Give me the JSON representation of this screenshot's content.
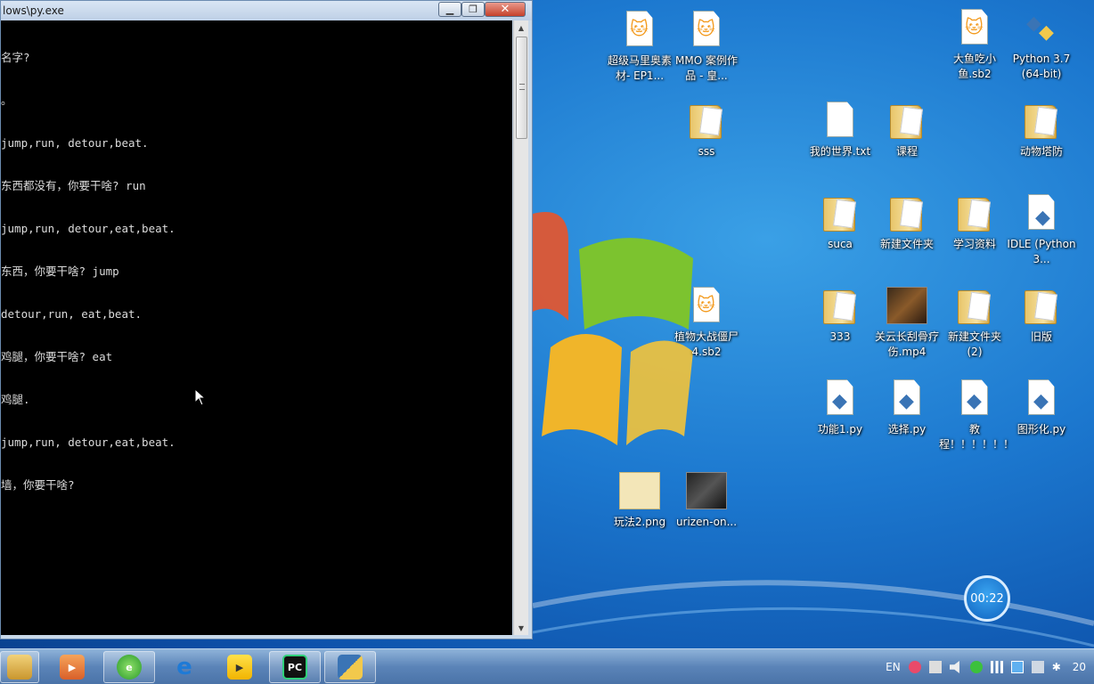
{
  "console": {
    "title": "lows\\py.exe",
    "lines": [
      "名字?",
      "。",
      "jump,run, detour,beat.",
      "东西都没有，你要干啥? run",
      "jump,run, detour,eat,beat.",
      "东西，你要干啥? jump",
      "detour,run, eat,beat.",
      "鸡腿，你要干啥? eat",
      "鸡腿.",
      "jump,run, detour,eat,beat.",
      "墙，你要干啥?"
    ]
  },
  "desktop": {
    "icons": [
      {
        "label": "超级马里奥素材- EP1..."
      },
      {
        "label": "MMO 案例作品 - 皇..."
      },
      {
        "label": "大鱼吃小鱼.sb2"
      },
      {
        "label": "Python 3.7 (64-bit)"
      },
      {
        "label": "sss"
      },
      {
        "label": "我的世界.txt"
      },
      {
        "label": "课程"
      },
      {
        "label": "动物塔防"
      },
      {
        "label": "suca"
      },
      {
        "label": "新建文件夹"
      },
      {
        "label": "学习资料"
      },
      {
        "label": "IDLE (Python 3..."
      },
      {
        "label": "植物大战僵尸4.sb2"
      },
      {
        "label": "333"
      },
      {
        "label": "关云长刮骨疗伤.mp4"
      },
      {
        "label": "新建文件夹 (2)"
      },
      {
        "label": "旧版"
      },
      {
        "label": "功能1.py"
      },
      {
        "label": "选择.py"
      },
      {
        "label": "教程！！！！！！！.py"
      },
      {
        "label": "图形化.py"
      },
      {
        "label": "玩法2.png"
      },
      {
        "label": "urizen-on..."
      }
    ]
  },
  "timer": {
    "value": "00:22"
  },
  "tray": {
    "lang": "EN",
    "clock": "20"
  }
}
